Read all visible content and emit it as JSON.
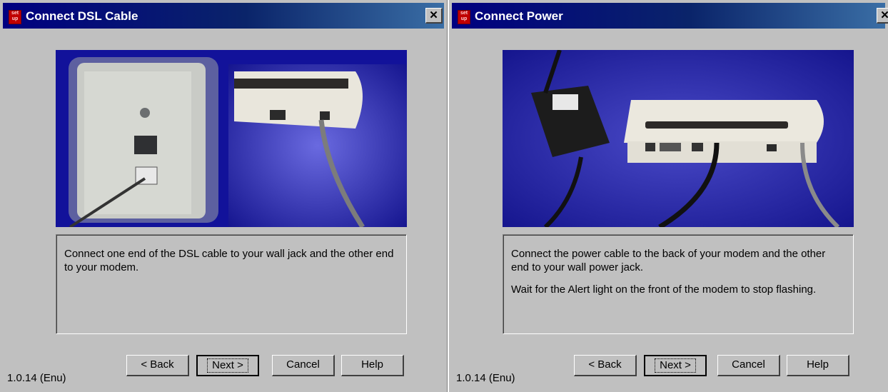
{
  "windows": [
    {
      "title": "Connect DSL Cable",
      "icon": "setup-icon",
      "icon_text": "set up",
      "description": [
        "Connect one end of the DSL cable to your wall jack and the other end to your modem."
      ],
      "buttons": {
        "back": "< Back",
        "next": "Next >",
        "cancel": "Cancel",
        "help": "Help"
      },
      "version": "1.0.14 (Enu)"
    },
    {
      "title": "Connect Power",
      "icon": "setup-icon",
      "icon_text": "set up",
      "description": [
        "Connect the power cable to the back of your modem and the other end to your wall power jack.",
        "Wait for the Alert light on the front of the modem to stop flashing."
      ],
      "buttons": {
        "back": "< Back",
        "next": "Next >",
        "cancel": "Cancel",
        "help": "Help"
      },
      "version": "1.0.14 (Enu)"
    }
  ],
  "colors": {
    "titlebar": "#000080",
    "dialog": "#c0c0c0",
    "photo_bg": "#1a1aa0"
  }
}
